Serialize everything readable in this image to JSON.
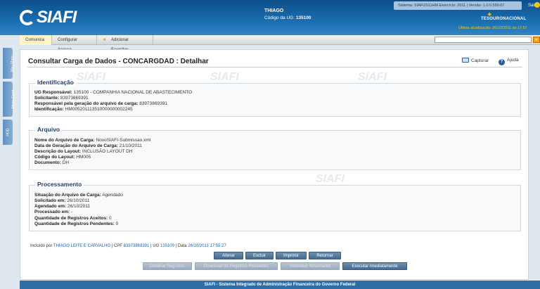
{
  "header": {
    "logo_text": "SIAFI",
    "user_name": "THIAGO",
    "ug_label": "Código da UG:",
    "ug_code": "135100",
    "system_info": "Sistema: SIAFI2011HM Exercício: 2011 | Versão: 1.0.0.559.67",
    "sair_label": "Sair",
    "tesouro_label": "TESOURONACIONAL",
    "last_update": "Última atualização: 26/10/2011 às 17:57"
  },
  "nav": {
    "tabs": [
      "Comunica",
      "Configurar Acesso",
      "Adicionar Favoritos"
    ],
    "go_label": "»"
  },
  "sidebar": {
    "tabs": [
      "Meu Menu",
      "Menu Geral",
      "HOD"
    ]
  },
  "page": {
    "title": "Consultar Carga de Dados - CONCARGDAD : Detalhar",
    "capturar_label": "Capturar",
    "ajuda_label": "Ajuda"
  },
  "identificacao": {
    "legend": "Identificação",
    "rows": [
      {
        "label": "UG Responsável:",
        "value": "135100 - COMPANHIA NACIONAL DE ABASTECIMENTO"
      },
      {
        "label": "Solicitante:",
        "value": "83973869391"
      },
      {
        "label": "Responsável pela geração do arquivo de carga:",
        "value": "83973869391"
      },
      {
        "label": "Identificação:",
        "value": "HM005201113510000000002245"
      }
    ]
  },
  "arquivo": {
    "legend": "Arquivo",
    "rows": [
      {
        "label": "Nome do Arquivo de Carga:",
        "value": "NovoSIAFI-Submissao.xml"
      },
      {
        "label": "Data de Geração do Arquivo de Carga:",
        "value": "21/10/2011"
      },
      {
        "label": "Descrição do Layout:",
        "value": "INCLUSÃO LAYOUT DH"
      },
      {
        "label": "Código do Layout:",
        "value": "HM005"
      },
      {
        "label": "Documento:",
        "value": "DH"
      }
    ]
  },
  "processamento": {
    "legend": "Processamento",
    "rows": [
      {
        "label": "Situação do Arquivo de Carga:",
        "value": "Agendado"
      },
      {
        "label": "Solicitado em:",
        "value": "26/10/2011"
      },
      {
        "label": "Agendado em:",
        "value": "26/10/2011"
      },
      {
        "label": "Processado em:",
        "value": "-"
      },
      {
        "label": "Quantidade de Registros Aceitos:",
        "value": "0"
      },
      {
        "label": "Quantidade de Registros Pendentes:",
        "value": "0"
      }
    ]
  },
  "meta": {
    "incluido_por": "Incluído por",
    "user": "THIAGO LEITE E CARVALHO",
    "cpf_label": "| CPF",
    "cpf": "83973869391",
    "ug_label": "| UG",
    "ug": "135100",
    "data_label": "| Data",
    "data": "26/10/2011 17:55:27"
  },
  "buttons": {
    "row1": [
      "Alterar",
      "Excluir",
      "Imprimir",
      "Retornar"
    ],
    "row2": [
      "Detalhar Registros",
      "Download de Registros Pendentes",
      "Submeter Novamente",
      "Executar Imediatamente"
    ]
  },
  "footer": {
    "text": "SIAFI - Sistema Integrado de Administração Financeira do Governo Federal"
  },
  "watermark": "SIAFI",
  "colors": {
    "header_blue": "#1a6eb0",
    "accent_yellow": "#f3c319",
    "button_blue": "#466b90",
    "link_blue": "#1f5ea8"
  }
}
